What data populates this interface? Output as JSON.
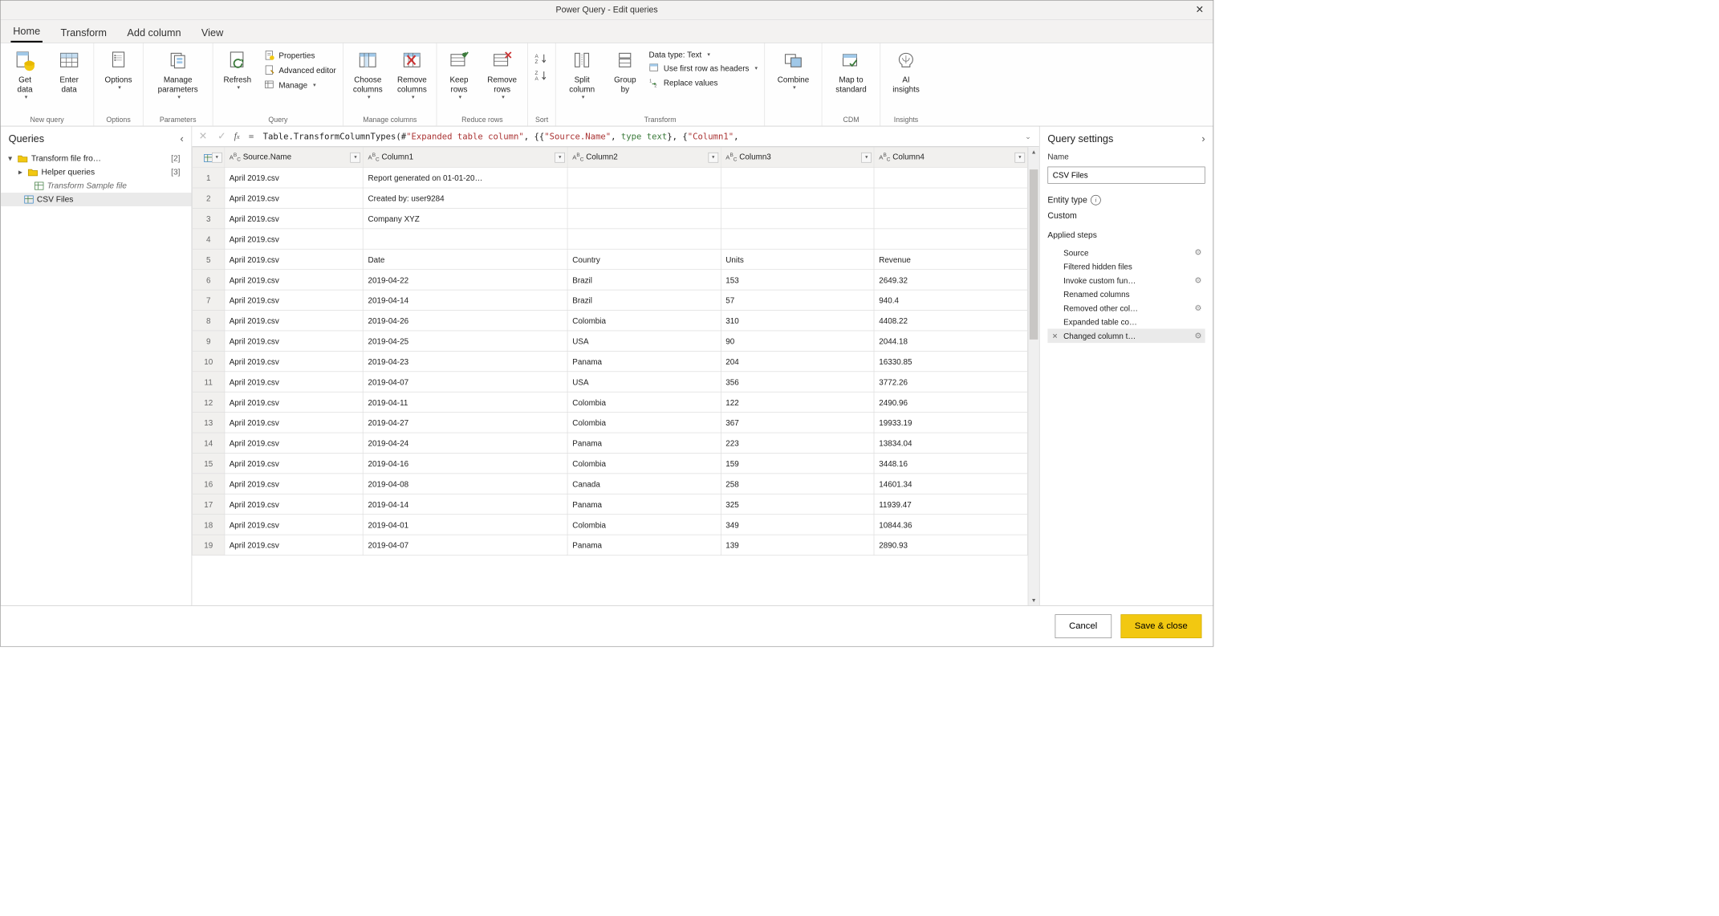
{
  "window": {
    "title": "Power Query - Edit queries"
  },
  "tabs": {
    "items": [
      "Home",
      "Transform",
      "Add column",
      "View"
    ],
    "active": 0
  },
  "ribbon": {
    "groups": {
      "new_query": {
        "label": "New query",
        "get_data": "Get\ndata",
        "enter_data": "Enter\ndata"
      },
      "options_g": {
        "label": "Options",
        "options": "Options"
      },
      "parameters": {
        "label": "Parameters",
        "manage_parameters": "Manage\nparameters"
      },
      "query": {
        "label": "Query",
        "refresh": "Refresh",
        "properties": "Properties",
        "advanced_editor": "Advanced editor",
        "manage": "Manage"
      },
      "manage_columns": {
        "label": "Manage columns",
        "choose": "Choose\ncolumns",
        "remove": "Remove\ncolumns"
      },
      "reduce_rows": {
        "label": "Reduce rows",
        "keep": "Keep\nrows",
        "remove": "Remove\nrows"
      },
      "sort": {
        "label": "Sort"
      },
      "transform": {
        "label": "Transform",
        "split": "Split\ncolumn",
        "group": "Group\nby",
        "datatype": "Data type: Text",
        "first_row": "Use first row as headers",
        "replace": "Replace values"
      },
      "combine": {
        "label": " ",
        "combine": "Combine"
      },
      "cdm": {
        "label": "CDM",
        "map": "Map to\nstandard"
      },
      "insights": {
        "label": "Insights",
        "ai": "AI\ninsights"
      }
    }
  },
  "queries_pane": {
    "title": "Queries",
    "items": [
      {
        "label": "Transform file fro…",
        "count": "[2]",
        "type": "folder",
        "expanded": true,
        "level": 0
      },
      {
        "label": "Helper queries",
        "count": "[3]",
        "type": "folder",
        "expanded": false,
        "level": 1
      },
      {
        "label": "Transform Sample file",
        "type": "query-italic",
        "level": 2
      },
      {
        "label": "CSV Files",
        "type": "query",
        "level": 1,
        "selected": true
      }
    ]
  },
  "formula": {
    "prefix": "Table.TransformColumnTypes(#",
    "str1": "\"Expanded table column\"",
    "mid": ", {{",
    "str2": "\"Source.Name\"",
    "mid2": ", ",
    "kw": "type text",
    "mid3": "}, {",
    "str3": "\"Column1\"",
    "tail": ","
  },
  "grid": {
    "columns": [
      "Source.Name",
      "Column1",
      "Column2",
      "Column3",
      "Column4"
    ],
    "rows": [
      [
        "April 2019.csv",
        "Report generated on 01-01-20…",
        "",
        "",
        ""
      ],
      [
        "April 2019.csv",
        "Created by: user9284",
        "",
        "",
        ""
      ],
      [
        "April 2019.csv",
        "Company XYZ",
        "",
        "",
        ""
      ],
      [
        "April 2019.csv",
        "",
        "",
        "",
        ""
      ],
      [
        "April 2019.csv",
        "Date",
        "Country",
        "Units",
        "Revenue"
      ],
      [
        "April 2019.csv",
        "2019-04-22",
        "Brazil",
        "153",
        "2649.32"
      ],
      [
        "April 2019.csv",
        "2019-04-14",
        "Brazil",
        "57",
        "940.4"
      ],
      [
        "April 2019.csv",
        "2019-04-26",
        "Colombia",
        "310",
        "4408.22"
      ],
      [
        "April 2019.csv",
        "2019-04-25",
        "USA",
        "90",
        "2044.18"
      ],
      [
        "April 2019.csv",
        "2019-04-23",
        "Panama",
        "204",
        "16330.85"
      ],
      [
        "April 2019.csv",
        "2019-04-07",
        "USA",
        "356",
        "3772.26"
      ],
      [
        "April 2019.csv",
        "2019-04-11",
        "Colombia",
        "122",
        "2490.96"
      ],
      [
        "April 2019.csv",
        "2019-04-27",
        "Colombia",
        "367",
        "19933.19"
      ],
      [
        "April 2019.csv",
        "2019-04-24",
        "Panama",
        "223",
        "13834.04"
      ],
      [
        "April 2019.csv",
        "2019-04-16",
        "Colombia",
        "159",
        "3448.16"
      ],
      [
        "April 2019.csv",
        "2019-04-08",
        "Canada",
        "258",
        "14601.34"
      ],
      [
        "April 2019.csv",
        "2019-04-14",
        "Panama",
        "325",
        "11939.47"
      ],
      [
        "April 2019.csv",
        "2019-04-01",
        "Colombia",
        "349",
        "10844.36"
      ],
      [
        "April 2019.csv",
        "2019-04-07",
        "Panama",
        "139",
        "2890.93"
      ]
    ]
  },
  "settings": {
    "title": "Query settings",
    "name_label": "Name",
    "name_value": "CSV Files",
    "entity_label": "Entity type",
    "entity_value": "Custom",
    "steps_label": "Applied steps",
    "steps": [
      {
        "label": "Source",
        "gear": true
      },
      {
        "label": "Filtered hidden files",
        "gear": false
      },
      {
        "label": "Invoke custom fun…",
        "gear": true
      },
      {
        "label": "Renamed columns",
        "gear": false
      },
      {
        "label": "Removed other col…",
        "gear": true
      },
      {
        "label": "Expanded table co…",
        "gear": false
      },
      {
        "label": "Changed column t…",
        "gear": true,
        "selected": true
      }
    ]
  },
  "footer": {
    "cancel": "Cancel",
    "save": "Save & close"
  }
}
